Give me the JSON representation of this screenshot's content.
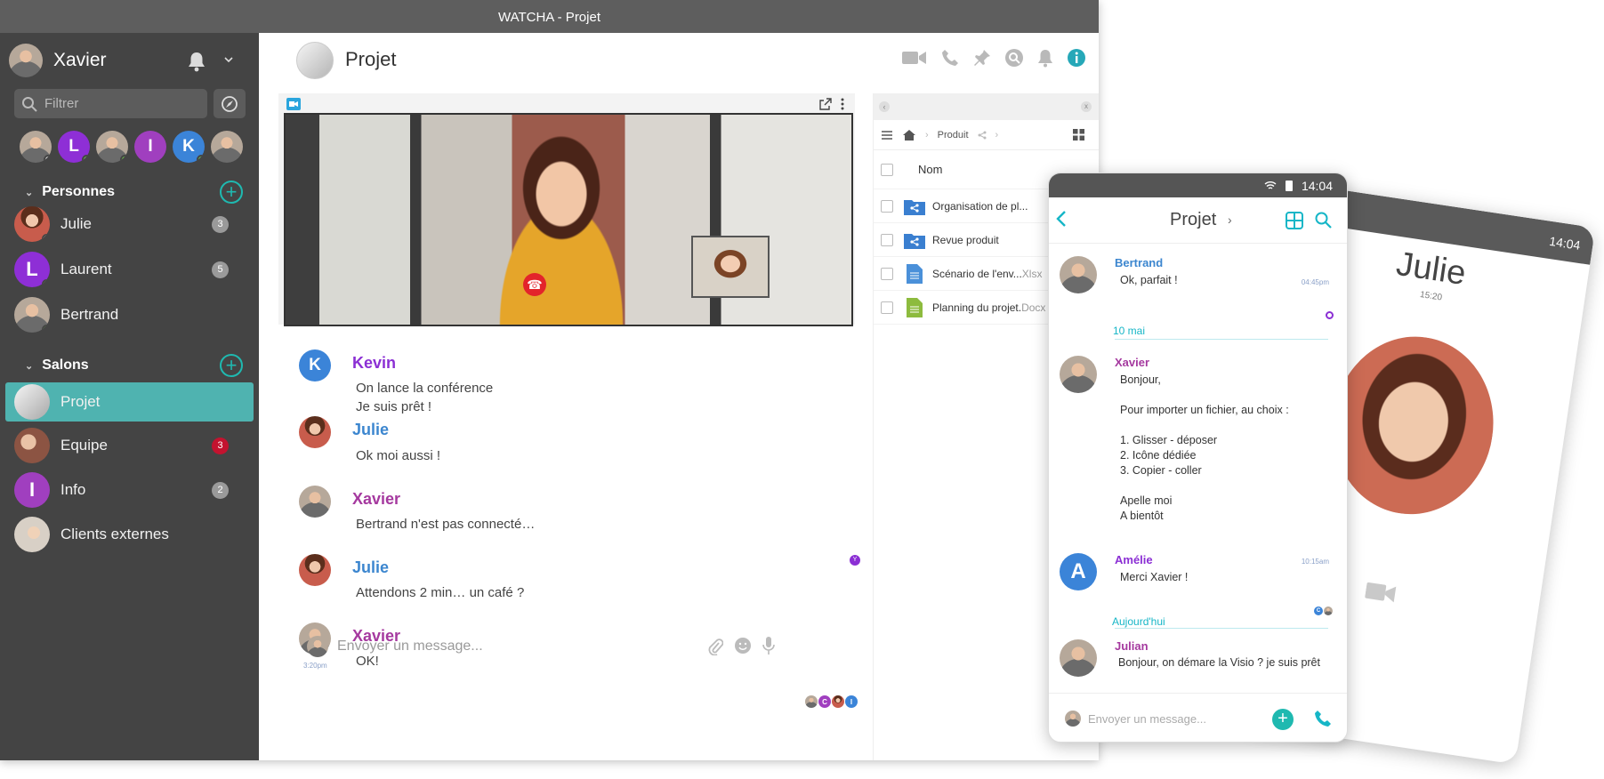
{
  "window": {
    "title": "WATCHA - Projet"
  },
  "sidebar": {
    "user_name": "Xavier",
    "filter_placeholder": "Filtrer",
    "recent": [
      {
        "letter": "",
        "color": "#a8a8a8",
        "status": "#e0e0e0"
      },
      {
        "letter": "L",
        "color": "#8e2fd6",
        "status": "#6cc04a"
      },
      {
        "letter": "",
        "color": "#9b8f86",
        "status": "#6cc04a"
      },
      {
        "letter": "I",
        "color": "#a03fbf",
        "status": ""
      },
      {
        "letter": "K",
        "color": "#3b84d8",
        "status": "#6cc04a"
      },
      {
        "letter": "",
        "color": "#a86b5a",
        "status": ""
      }
    ],
    "people_section": "Personnes",
    "people": [
      {
        "name": "Julie",
        "badge": "3"
      },
      {
        "name": "Laurent",
        "badge": "5",
        "letter": "L"
      },
      {
        "name": "Bertrand",
        "badge": ""
      }
    ],
    "rooms_section": "Salons",
    "rooms": [
      {
        "name": "Projet",
        "badge": ""
      },
      {
        "name": "Equipe",
        "badge": "3"
      },
      {
        "name": "Info",
        "badge": "2",
        "letter": "I"
      },
      {
        "name": "Clients externes",
        "badge": ""
      }
    ]
  },
  "room": {
    "title": "Projet"
  },
  "messages": [
    {
      "sender": "Kevin",
      "color": "#8b2fd4",
      "letter": "K",
      "lines": [
        "On lance la conférence",
        "Je suis prêt !"
      ]
    },
    {
      "sender": "Julie",
      "color": "#3c86cf",
      "lines": [
        "Ok moi aussi !"
      ]
    },
    {
      "sender": "Xavier",
      "color": "#a5399f",
      "lines": [
        "Bertrand n'est pas connecté…"
      ]
    },
    {
      "sender": "Julie",
      "color": "#3c86cf",
      "lines": [
        "Attendons 2 min… un café ?"
      ]
    },
    {
      "sender": "Xavier",
      "color": "#a5399f",
      "lines": [
        "OK!"
      ],
      "time": "3:20pm"
    }
  ],
  "read_marker": "Y",
  "read_receipts": [
    "C",
    "I"
  ],
  "composer": {
    "placeholder": "Envoyer un message..."
  },
  "files": {
    "breadcrumb": "Produit",
    "column": "Nom",
    "rows": [
      {
        "name": "Organisation de pl...",
        "ext": "",
        "type": "shared-folder"
      },
      {
        "name": "Revue produit",
        "ext": "",
        "type": "shared-folder"
      },
      {
        "name": "Scénario de l'env...",
        "ext": "Xlsx",
        "type": "doc"
      },
      {
        "name": "Planning du projet.",
        "ext": "Docx",
        "type": "sheet"
      }
    ]
  },
  "phone": {
    "time": "14:04",
    "title": "Projet",
    "messages": [
      {
        "sender": "Bertrand",
        "lines": [
          "Ok, parfait !"
        ],
        "time": "04:45pm"
      },
      {
        "date": "10 mai"
      },
      {
        "sender": "Xavier",
        "lines": [
          "Bonjour,",
          "",
          "Pour importer un fichier, au choix :",
          "",
          "1. Glisser - déposer",
          "2. Icône dédiée",
          "3. Copier - coller",
          "",
          "Apelle moi",
          "A bientôt"
        ]
      },
      {
        "sender": "Amélie",
        "letter": "A",
        "lines": [
          "Merci Xavier !"
        ],
        "time": "10:15am"
      },
      {
        "date": "Aujourd'hui"
      },
      {
        "sender": "Julian",
        "lines": [
          "Bonjour, on démare la Visio ? je suis prêt"
        ]
      }
    ],
    "composer_placeholder": "Envoyer un message...",
    "receipt_letter": "C"
  },
  "call": {
    "time": "14:04",
    "name": "Julie",
    "duration": "15:20"
  },
  "colors": {
    "accent": "#1fb9b0",
    "sidebar": "#444444",
    "active_room": "#4fb3b0",
    "hangup": "#e3242b"
  }
}
